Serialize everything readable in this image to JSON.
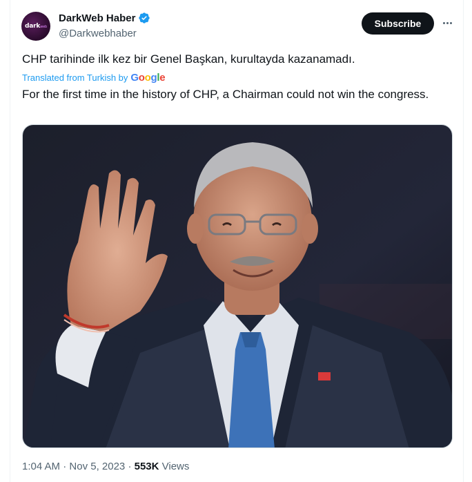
{
  "author": {
    "display_name": "DarkWeb Haber",
    "handle": "@Darkwebhaber",
    "avatar_text": "dark",
    "avatar_subtext": "web",
    "verified": true,
    "verified_color": "#1d9bf0"
  },
  "actions": {
    "subscribe_label": "Subscribe",
    "more_icon": "more-horizontal-icon"
  },
  "tweet": {
    "text": "CHP tarihinde ilk kez bir Genel Başkan, kurultayda kazanamadı.",
    "translated_from": "Translated from Turkish by",
    "translator_letters": [
      "G",
      "o",
      "o",
      "g",
      "l",
      "e"
    ],
    "translation": "For the first time in the history of CHP, a Chairman could not win the congress.",
    "link_color": "#1d9bf0"
  },
  "meta": {
    "time": "1:04 AM",
    "sep1": " · ",
    "date": "Nov 5, 2023",
    "sep2": " · ",
    "views_count": "553K",
    "views_label": " Views"
  }
}
